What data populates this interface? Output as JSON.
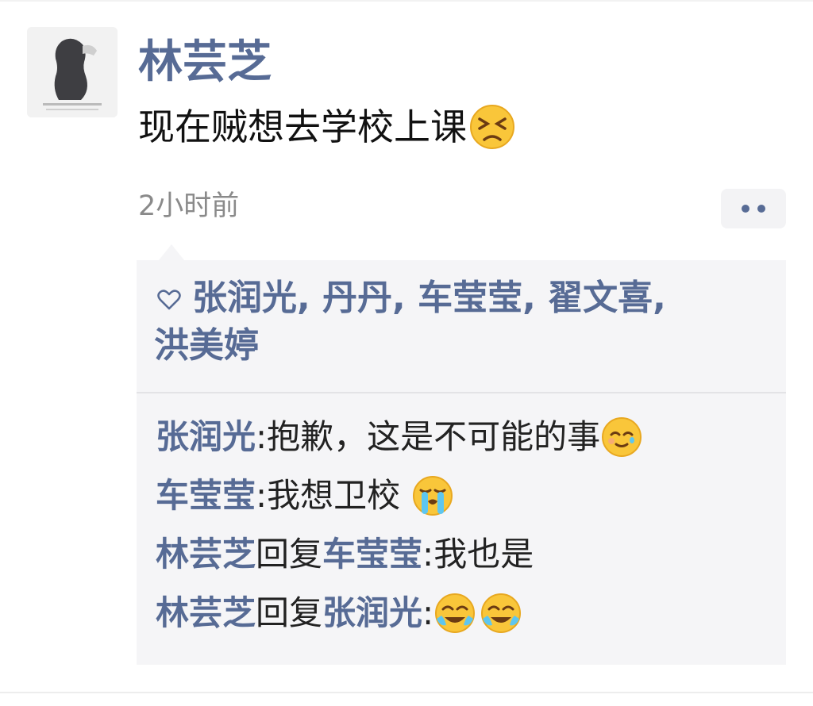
{
  "post": {
    "author": "林芸芝",
    "text": "现在贼想去学校上课",
    "text_emoji": "persevering-face",
    "time": "2小时前"
  },
  "likes": {
    "icon": "heart-outline-icon",
    "names": [
      "张润光",
      "丹丹",
      "车莹莹",
      "翟文喜",
      "洪美婷"
    ],
    "line1": "张润光, 丹丹, 车莹莹, 翟文喜,",
    "line2": "洪美婷"
  },
  "comments": [
    {
      "author": "张润光",
      "separator": ": ",
      "text": "抱歉，这是不可能的事",
      "emoji": [
        "smiling-face-with-tear"
      ]
    },
    {
      "author": "车莹莹",
      "separator": ": ",
      "text": "我想卫校 ",
      "emoji": [
        "loudly-crying-face"
      ]
    },
    {
      "author": "林芸芝",
      "reply_word": "回复",
      "reply_to": "车莹莹",
      "separator": ": ",
      "text": "我也是",
      "emoji": []
    },
    {
      "author": "林芸芝",
      "reply_word": "回复",
      "reply_to": "张润光",
      "separator": ": ",
      "text": "",
      "emoji": [
        "face-with-tears-of-joy",
        "face-with-tears-of-joy"
      ]
    }
  ],
  "colors": {
    "name_blue": "#576b95",
    "text": "#111111",
    "time_gray": "#8a8a8a",
    "panel_bg": "#f5f5f7"
  }
}
